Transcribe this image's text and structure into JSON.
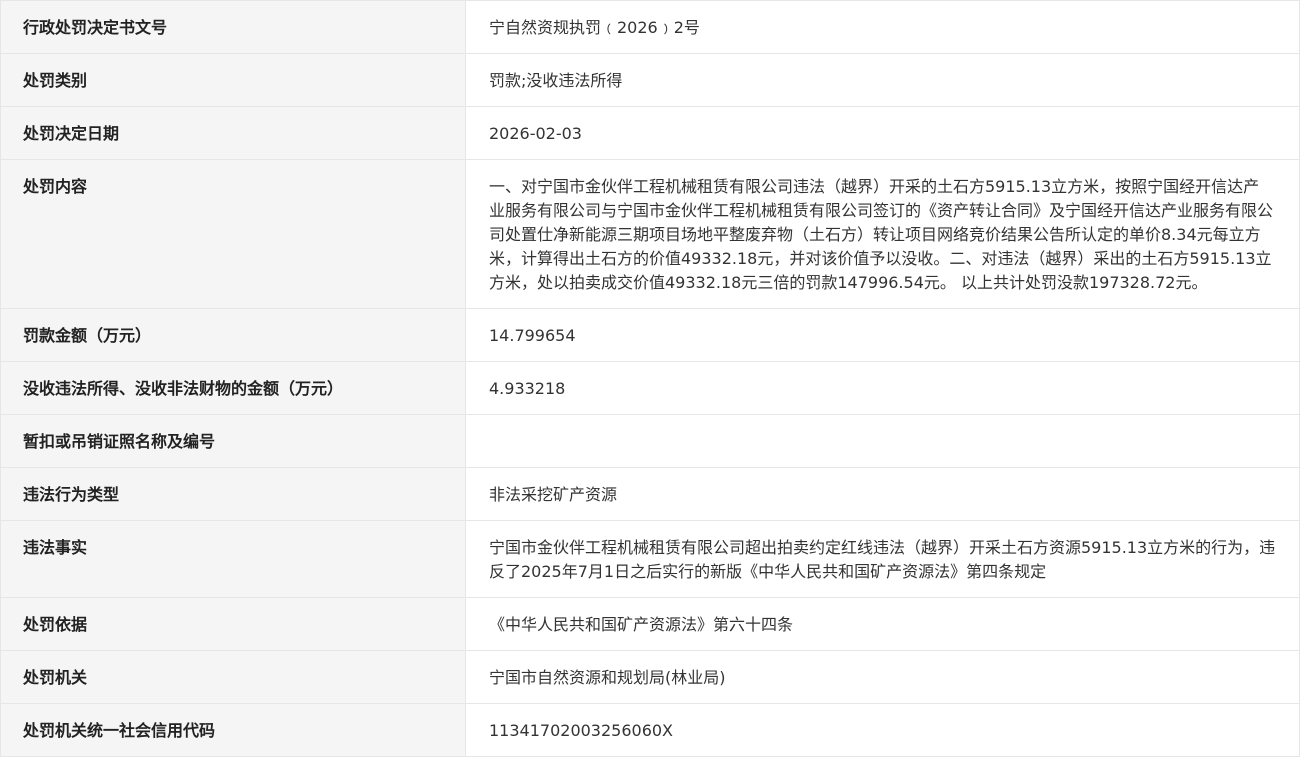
{
  "rows": [
    {
      "label": "行政处罚决定书文号",
      "value": "宁自然资规执罚﹙2026﹚2号"
    },
    {
      "label": "处罚类别",
      "value": "罚款;没收违法所得"
    },
    {
      "label": "处罚决定日期",
      "value": "2026-02-03"
    },
    {
      "label": "处罚内容",
      "value": "一、对宁国市金伙伴工程机械租赁有限公司违法（越界）开采的土石方5915.13立方米，按照宁国经开信达产业服务有限公司与宁国市金伙伴工程机械租赁有限公司签订的《资产转让合同》及宁国经开信达产业服务有限公司处置仕净新能源三期项目场地平整废弃物（土石方）转让项目网络竞价结果公告所认定的单价8.34元每立方米，计算得出土石方的价值49332.18元，并对该价值予以没收。二、对违法（越界）采出的土石方5915.13立方米，处以拍卖成交价值49332.18元三倍的罚款147996.54元。 以上共计处罚没款197328.72元。"
    },
    {
      "label": "罚款金额（万元）",
      "value": "14.799654"
    },
    {
      "label": "没收违法所得、没收非法财物的金额（万元）",
      "value": "4.933218"
    },
    {
      "label": "暂扣或吊销证照名称及编号",
      "value": ""
    },
    {
      "label": "违法行为类型",
      "value": "非法采挖矿产资源"
    },
    {
      "label": "违法事实",
      "value": "宁国市金伙伴工程机械租赁有限公司超出拍卖约定红线违法（越界）开采土石方资源5915.13立方米的行为，违反了2025年7月1日之后实行的新版《中华人民共和国矿产资源法》第四条规定"
    },
    {
      "label": "处罚依据",
      "value": "《中华人民共和国矿产资源法》第六十四条"
    },
    {
      "label": "处罚机关",
      "value": "宁国市自然资源和规划局(林业局)"
    },
    {
      "label": "处罚机关统一社会信用代码",
      "value": "11341702003256060X"
    }
  ]
}
